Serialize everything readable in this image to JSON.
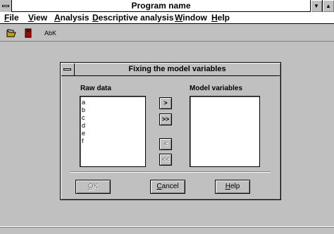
{
  "window": {
    "title": "Program name",
    "minimize_glyph": "▼",
    "maximize_glyph": "▲"
  },
  "menubar": {
    "items": [
      {
        "label_ul": "F",
        "label_rest": "ile"
      },
      {
        "label_ul": "V",
        "label_rest": "iew"
      },
      {
        "label_ul": "A",
        "label_rest": "nalysis"
      },
      {
        "label_ul": "D",
        "label_rest": "escriptive analysis"
      },
      {
        "label_ul": "W",
        "label_rest": "indow"
      },
      {
        "label_ul": "H",
        "label_rest": "elp"
      }
    ]
  },
  "toolbar": {
    "icons": [
      "open-folder-icon",
      "book-icon"
    ],
    "text_tool": "AbK"
  },
  "dialog": {
    "title": "Fixing the model variables",
    "raw_data_label": "Raw data",
    "model_variables_label": "Model variables",
    "raw_items": [
      "a",
      "b",
      "c",
      "d",
      "e",
      "f"
    ],
    "model_items": [],
    "move_one_right": ">",
    "move_all_right": ">>",
    "move_one_left": "<",
    "move_all_left": "<<",
    "ok_label_ul": "O",
    "ok_label_rest": "K",
    "cancel_label_ul": "C",
    "cancel_label_rest": "ancel",
    "help_label_ul": "H",
    "help_label_rest": "elp"
  }
}
